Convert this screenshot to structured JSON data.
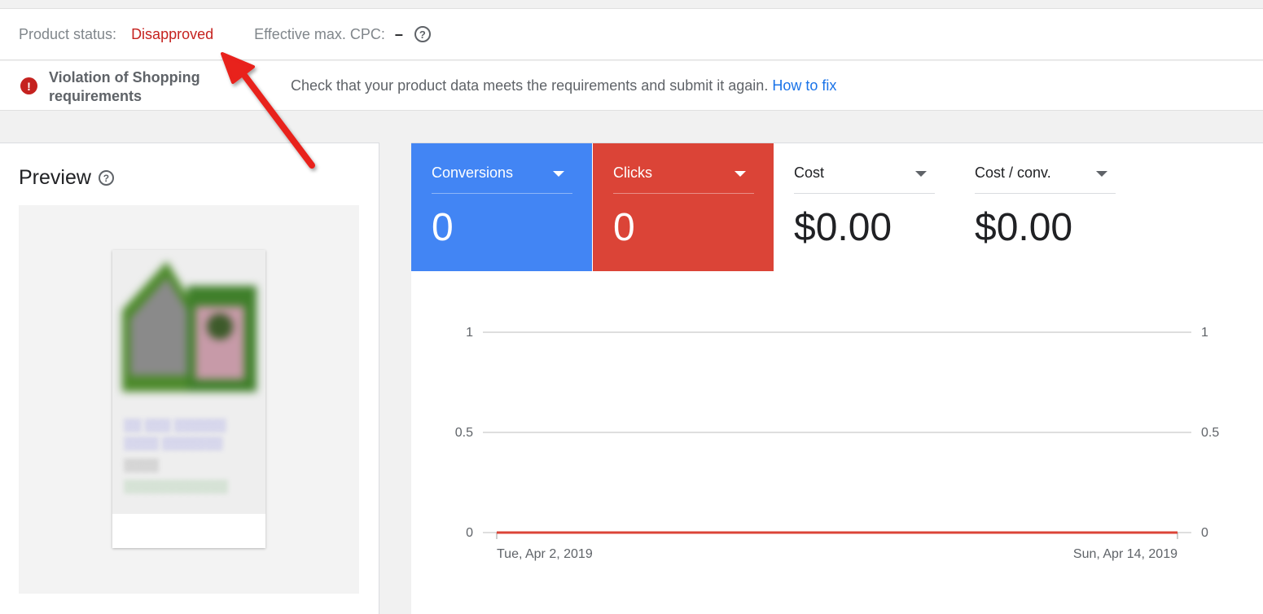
{
  "status_bar": {
    "product_status_label": "Product status:",
    "product_status_value": "Disapproved",
    "cpc_label": "Effective max. CPC:",
    "cpc_value": "–",
    "help_glyph": "?"
  },
  "violation": {
    "title": "Violation of Shopping requirements",
    "message": "Check that your product data meets the requirements and submit it again.",
    "link": "How to fix",
    "icon": "error-icon"
  },
  "preview": {
    "title": "Preview",
    "help_glyph": "?"
  },
  "metrics": [
    {
      "label": "Conversions",
      "value": "0",
      "color": "#4285f4"
    },
    {
      "label": "Clicks",
      "value": "0",
      "color": "#db4437"
    },
    {
      "label": "Cost",
      "value": "$0.00"
    },
    {
      "label": "Cost / conv.",
      "value": "$0.00"
    }
  ],
  "chart_data": {
    "type": "line",
    "x": [
      "Tue, Apr 2, 2019",
      "Sun, Apr 14, 2019"
    ],
    "x_tick_labels": [
      "Tue, Apr 2, 2019",
      "Sun, Apr 14, 2019"
    ],
    "y_ticks": [
      "1",
      "0.5",
      "0"
    ],
    "y_ticks_right": [
      "1",
      "0.5",
      "0"
    ],
    "ylim": [
      0,
      1
    ],
    "series": [
      {
        "name": "Clicks",
        "values": [
          0,
          0
        ],
        "color": "#db4437"
      }
    ],
    "grid": true
  },
  "colors": {
    "accent_blue": "#4285f4",
    "accent_red": "#db4437",
    "status_red": "#c5221f",
    "link_blue": "#1a73e8"
  }
}
